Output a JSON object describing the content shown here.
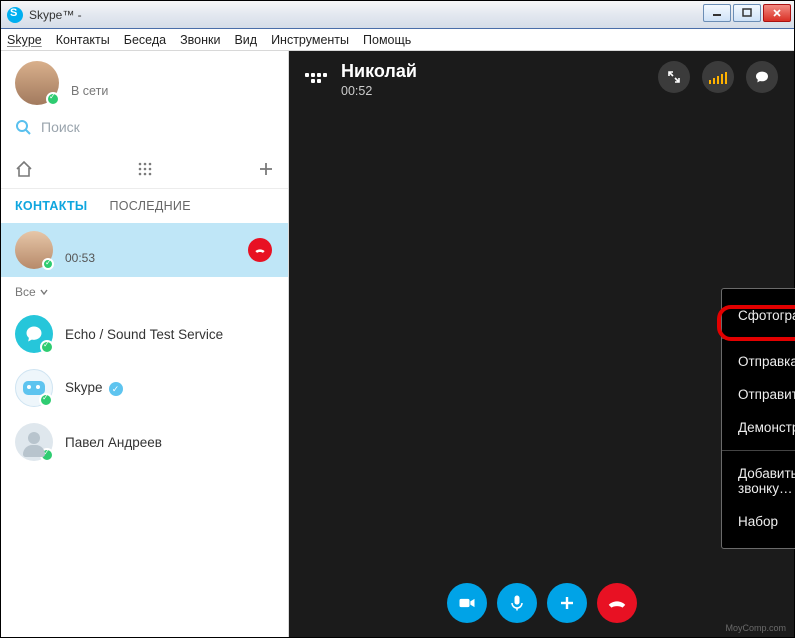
{
  "window": {
    "title_prefix": "Skype™ -"
  },
  "menu": {
    "items": [
      "Skype",
      "Контакты",
      "Беседа",
      "Звонки",
      "Вид",
      "Инструменты",
      "Помощь"
    ]
  },
  "profile": {
    "status": "В сети"
  },
  "search": {
    "placeholder": "Поиск"
  },
  "tabs": {
    "contacts": "КОНТАКТЫ",
    "recent": "ПОСЛЕДНИЕ"
  },
  "filter": {
    "label": "Все"
  },
  "active_call_row": {
    "duration": "00:53"
  },
  "contacts": [
    {
      "label": "Echo / Sound Test Service"
    },
    {
      "label": "Skype"
    },
    {
      "label": "Павел Андреев"
    }
  ],
  "call": {
    "name": "Николай",
    "timer": "00:52"
  },
  "popup": {
    "snapshot": "Сфотографировать…",
    "send_files": "Отправка файлов…",
    "send_contacts": "Отправить контакты…",
    "share_screen": "Демонстрация экрана…",
    "add_people": "Добавить участников к этому звонку…",
    "dialpad": "Набор"
  },
  "watermark": "MoyComp.com"
}
